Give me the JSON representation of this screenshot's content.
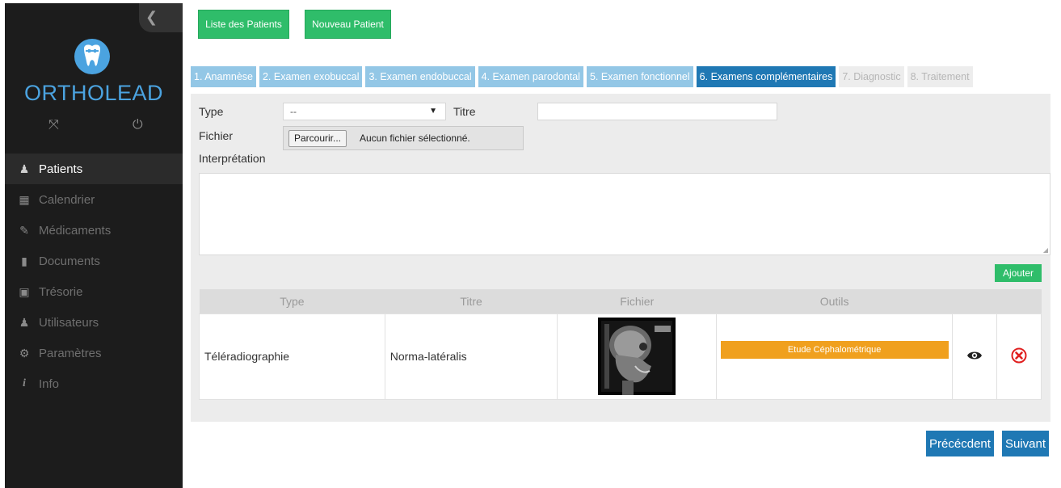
{
  "sidebar": {
    "brand": "ORTHOLEAD",
    "items": [
      {
        "label": "Patients",
        "icon": "patient-icon",
        "glyph": "♟",
        "active": true
      },
      {
        "label": "Calendrier",
        "icon": "calendar-icon",
        "glyph": "▦",
        "active": false
      },
      {
        "label": "Médicaments",
        "icon": "pill-icon",
        "glyph": "✎",
        "active": false
      },
      {
        "label": "Documents",
        "icon": "document-icon",
        "glyph": "▮",
        "active": false
      },
      {
        "label": "Trésorie",
        "icon": "safe-icon",
        "glyph": "▣",
        "active": false
      },
      {
        "label": "Utilisateurs",
        "icon": "user-icon",
        "glyph": "♟",
        "active": false
      },
      {
        "label": "Paramètres",
        "icon": "settings-icon",
        "glyph": "⚙",
        "active": false
      },
      {
        "label": "Info",
        "icon": "info-icon",
        "glyph": "i",
        "active": false
      }
    ]
  },
  "top": {
    "list_label": "Liste des Patients",
    "new_label": "Nouveau Patient"
  },
  "tabs": [
    {
      "label": "1. Anamnèse",
      "state": "normal"
    },
    {
      "label": "2. Examen exobuccal",
      "state": "normal"
    },
    {
      "label": "3. Examen endobuccal",
      "state": "normal"
    },
    {
      "label": "4. Examen parodontal",
      "state": "normal"
    },
    {
      "label": "5. Examen fonctionnel",
      "state": "normal"
    },
    {
      "label": "6. Examens complémentaires",
      "state": "active"
    },
    {
      "label": "7. Diagnostic",
      "state": "disabled"
    },
    {
      "label": "8. Traitement",
      "state": "disabled"
    }
  ],
  "form": {
    "type_label": "Type",
    "type_value": "--",
    "titre_label": "Titre",
    "titre_value": "",
    "fichier_label": "Fichier",
    "file_button": "Parcourir...",
    "file_text": "Aucun fichier sélectionné.",
    "interpretation_label": "Interprétation",
    "add_label": "Ajouter"
  },
  "table": {
    "headers": [
      "Type",
      "Titre",
      "Fichier",
      "Outils"
    ],
    "rows": [
      {
        "type": "Téléradiographie",
        "titre": "Norma-latéralis",
        "tool_label": "Etude Céphalométrique"
      }
    ]
  },
  "nav": {
    "prev_label": "Précécdent",
    "next_label": "Suivant"
  },
  "colors": {
    "green": "#2fbd6a",
    "blue": "#1f78b4",
    "tab_light": "#93c7e6",
    "orange": "#f0a01e",
    "danger": "#e02020"
  }
}
